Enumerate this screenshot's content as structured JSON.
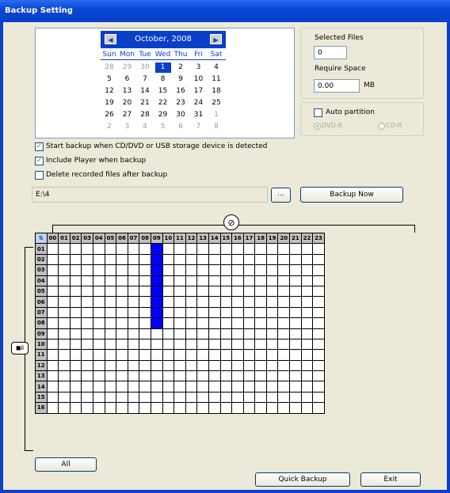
{
  "window": {
    "title": "Backup Setting"
  },
  "calendar": {
    "month_label": "October, 2008",
    "prev_label": "◀",
    "next_label": "▶",
    "weekdays": [
      "Sun",
      "Mon",
      "Tue",
      "Wed",
      "Thu",
      "Fri",
      "Sat"
    ],
    "weeks": [
      [
        "28",
        "29",
        "30",
        "1",
        "2",
        "3",
        "4"
      ],
      [
        "5",
        "6",
        "7",
        "8",
        "9",
        "10",
        "11"
      ],
      [
        "12",
        "13",
        "14",
        "15",
        "16",
        "17",
        "18"
      ],
      [
        "19",
        "20",
        "21",
        "22",
        "23",
        "24",
        "25"
      ],
      [
        "26",
        "27",
        "28",
        "29",
        "30",
        "31",
        "1"
      ],
      [
        "2",
        "3",
        "4",
        "5",
        "6",
        "7",
        "8"
      ]
    ],
    "selected_day": "1"
  },
  "info": {
    "selected_files_label": "Selected Files",
    "selected_files_value": "0",
    "require_space_label": "Require Space",
    "require_space_value": "0.00",
    "require_space_unit": "MB"
  },
  "partition": {
    "auto_label": "Auto partition",
    "auto_checked": false,
    "dvd_label": "DVD-R",
    "cd_label": "CD-R"
  },
  "options": {
    "start_backup_label": "Start backup when CD/DVD or USB storage device is detected",
    "start_backup_checked": true,
    "include_player_label": "Include Player when backup",
    "include_player_checked": true,
    "delete_files_label": "Delete recorded files after backup",
    "delete_files_checked": false
  },
  "path": {
    "value": "E:\\4",
    "browse_label": "...",
    "backup_now_label": "Backup Now"
  },
  "schedule": {
    "corner_label": "⇅",
    "hours": [
      "00",
      "01",
      "02",
      "03",
      "04",
      "05",
      "06",
      "07",
      "08",
      "09",
      "10",
      "11",
      "12",
      "13",
      "14",
      "15",
      "16",
      "17",
      "18",
      "19",
      "20",
      "21",
      "22",
      "23"
    ],
    "channels": [
      "01",
      "02",
      "03",
      "04",
      "05",
      "06",
      "07",
      "08",
      "09",
      "10",
      "11",
      "12",
      "13",
      "14",
      "15",
      "16"
    ],
    "selected_hour": "09",
    "selected_channels": [
      "01",
      "02",
      "03",
      "04",
      "05",
      "06",
      "07",
      "08"
    ],
    "selected_color": "#0000ff"
  },
  "buttons": {
    "all_label": "All",
    "quick_backup_label": "Quick Backup",
    "exit_label": "Exit"
  }
}
